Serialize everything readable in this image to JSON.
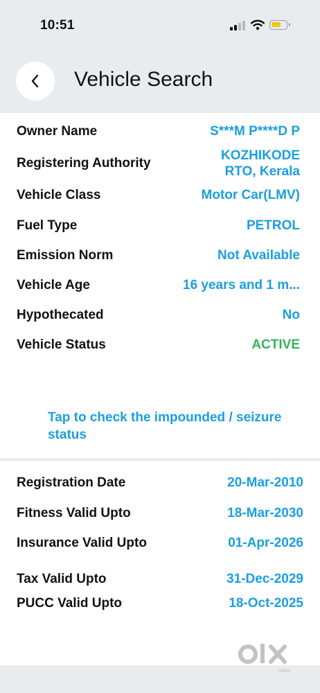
{
  "status_bar": {
    "time": "10:51"
  },
  "header": {
    "title": "Vehicle Search"
  },
  "details": [
    {
      "label": "Owner Name",
      "value": "S***M P****D P"
    },
    {
      "label": "Registering Authority",
      "value": "KOZHIKODE RTO, Kerala"
    },
    {
      "label": "Vehicle Class",
      "value": "Motor Car(LMV)"
    },
    {
      "label": "Fuel Type",
      "value": "PETROL"
    },
    {
      "label": "Emission Norm",
      "value": "Not Available"
    },
    {
      "label": "Vehicle Age",
      "value": "16 years and 1 m..."
    },
    {
      "label": "Hypothecated",
      "value": "No"
    },
    {
      "label": "Vehicle Status",
      "value": "ACTIVE"
    }
  ],
  "impound_link": "Tap to check the impounded / seizure status",
  "validity": [
    {
      "label": "Registration Date",
      "value": "20-Mar-2010"
    },
    {
      "label": "Fitness Valid Upto",
      "value": "18-Mar-2030"
    },
    {
      "label": "Insurance Valid Upto",
      "value": "01-Apr-2026"
    },
    {
      "label": "Tax Valid Upto",
      "value": "31-Dec-2029"
    },
    {
      "label": "PUCC Valid Upto",
      "value": "18-Oct-2025"
    }
  ],
  "watermark": {
    "brand": "olx",
    "sub": "INDIA"
  },
  "colors": {
    "accent": "#1a9fe0",
    "active": "#34b45a",
    "background": "#e9ecef"
  },
  "icons": [
    "back-chevron-icon",
    "cellular-signal-icon",
    "wifi-icon",
    "battery-icon"
  ]
}
